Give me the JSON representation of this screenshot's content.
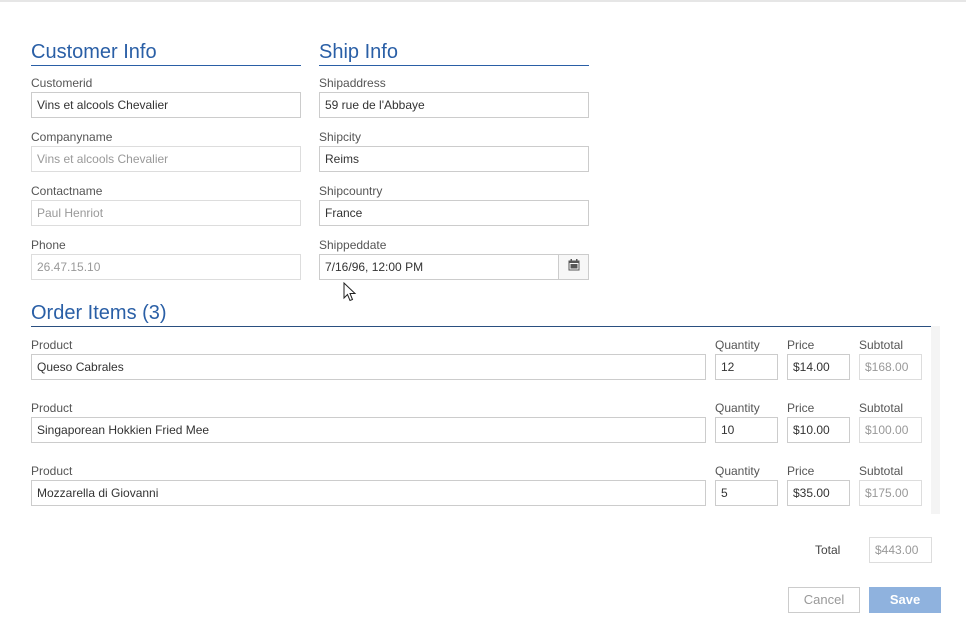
{
  "customer": {
    "title": "Customer Info",
    "customerid_label": "Customerid",
    "customerid_value": "Vins et alcools Chevalier",
    "companyname_label": "Companyname",
    "companyname_value": "Vins et alcools Chevalier",
    "contactname_label": "Contactname",
    "contactname_value": "Paul Henriot",
    "phone_label": "Phone",
    "phone_value": "26.47.15.10"
  },
  "ship": {
    "title": "Ship Info",
    "address_label": "Shipaddress",
    "address_value": "59 rue de l'Abbaye",
    "city_label": "Shipcity",
    "city_value": "Reims",
    "country_label": "Shipcountry",
    "country_value": "France",
    "date_label": "Shippeddate",
    "date_value": "7/16/96, 12:00 PM"
  },
  "order": {
    "title": "Order Items (3)",
    "product_label": "Product",
    "quantity_label": "Quantity",
    "price_label": "Price",
    "subtotal_label": "Subtotal",
    "items": [
      {
        "product": "Queso Cabrales",
        "quantity": "12",
        "price": "$14.00",
        "subtotal": "$168.00"
      },
      {
        "product": "Singaporean Hokkien Fried Mee",
        "quantity": "10",
        "price": "$10.00",
        "subtotal": "$100.00"
      },
      {
        "product": "Mozzarella di Giovanni",
        "quantity": "5",
        "price": "$35.00",
        "subtotal": "$175.00"
      }
    ],
    "total_label": "Total",
    "total_value": "$443.00"
  },
  "actions": {
    "cancel_label": "Cancel",
    "save_label": "Save"
  },
  "colors": {
    "accent": "#2a5fa6",
    "save_button": "#8fb2de"
  }
}
